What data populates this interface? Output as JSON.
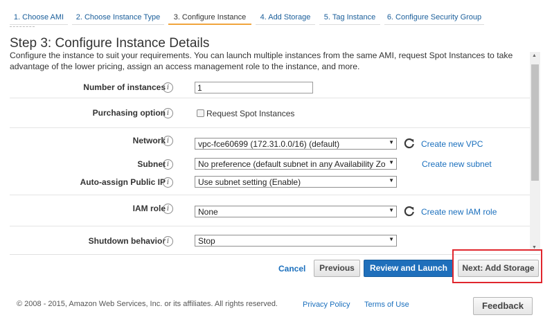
{
  "wizard": {
    "tabs": [
      {
        "label": "1. Choose AMI"
      },
      {
        "label": "2. Choose Instance Type"
      },
      {
        "label": "3. Configure Instance"
      },
      {
        "label": "4. Add Storage"
      },
      {
        "label": "5. Tag Instance"
      },
      {
        "label": "6. Configure Security Group"
      }
    ],
    "active_tab": "3. Configure Instance"
  },
  "page": {
    "title": "Step 3: Configure Instance Details",
    "description": "Configure the instance to suit your requirements. You can launch multiple instances from the same AMI, request Spot Instances to take advantage of the lower pricing, assign an access management role to the instance, and more."
  },
  "form": {
    "info_glyph": "i",
    "number_of_instances": {
      "label": "Number of instances",
      "value": "1"
    },
    "purchasing_option": {
      "label": "Purchasing option",
      "checkbox_label": "Request Spot Instances",
      "checked": false
    },
    "network": {
      "label": "Network",
      "value": "vpc-fce60699 (172.31.0.0/16) (default)",
      "link": "Create new VPC"
    },
    "subnet": {
      "label": "Subnet",
      "value": "No preference (default subnet in any Availability Zo",
      "link": "Create new subnet"
    },
    "auto_assign_ip": {
      "label": "Auto-assign Public IP",
      "value": "Use subnet setting (Enable)"
    },
    "iam_role": {
      "label": "IAM role",
      "value": "None",
      "link": "Create new IAM role"
    },
    "shutdown_behavior": {
      "label": "Shutdown behavior",
      "value": "Stop"
    }
  },
  "actions": {
    "cancel": "Cancel",
    "previous": "Previous",
    "review_and_launch": "Review and Launch",
    "next": "Next: Add Storage"
  },
  "footer": {
    "copyright": "© 2008 - 2015, Amazon Web Services, Inc. or its affiliates. All rights reserved.",
    "privacy_policy": "Privacy Policy",
    "terms_of_use": "Terms of Use",
    "feedback": "Feedback"
  },
  "colors": {
    "link": "#1a6fbd",
    "primary_button": "#1f6fbb",
    "active_tab_underline": "#f0a43c",
    "highlight_box": "#e0262d"
  },
  "icons": {
    "info": "info-icon",
    "refresh": "refresh-icon",
    "select_arrow": "dropdown-arrow-icon"
  }
}
